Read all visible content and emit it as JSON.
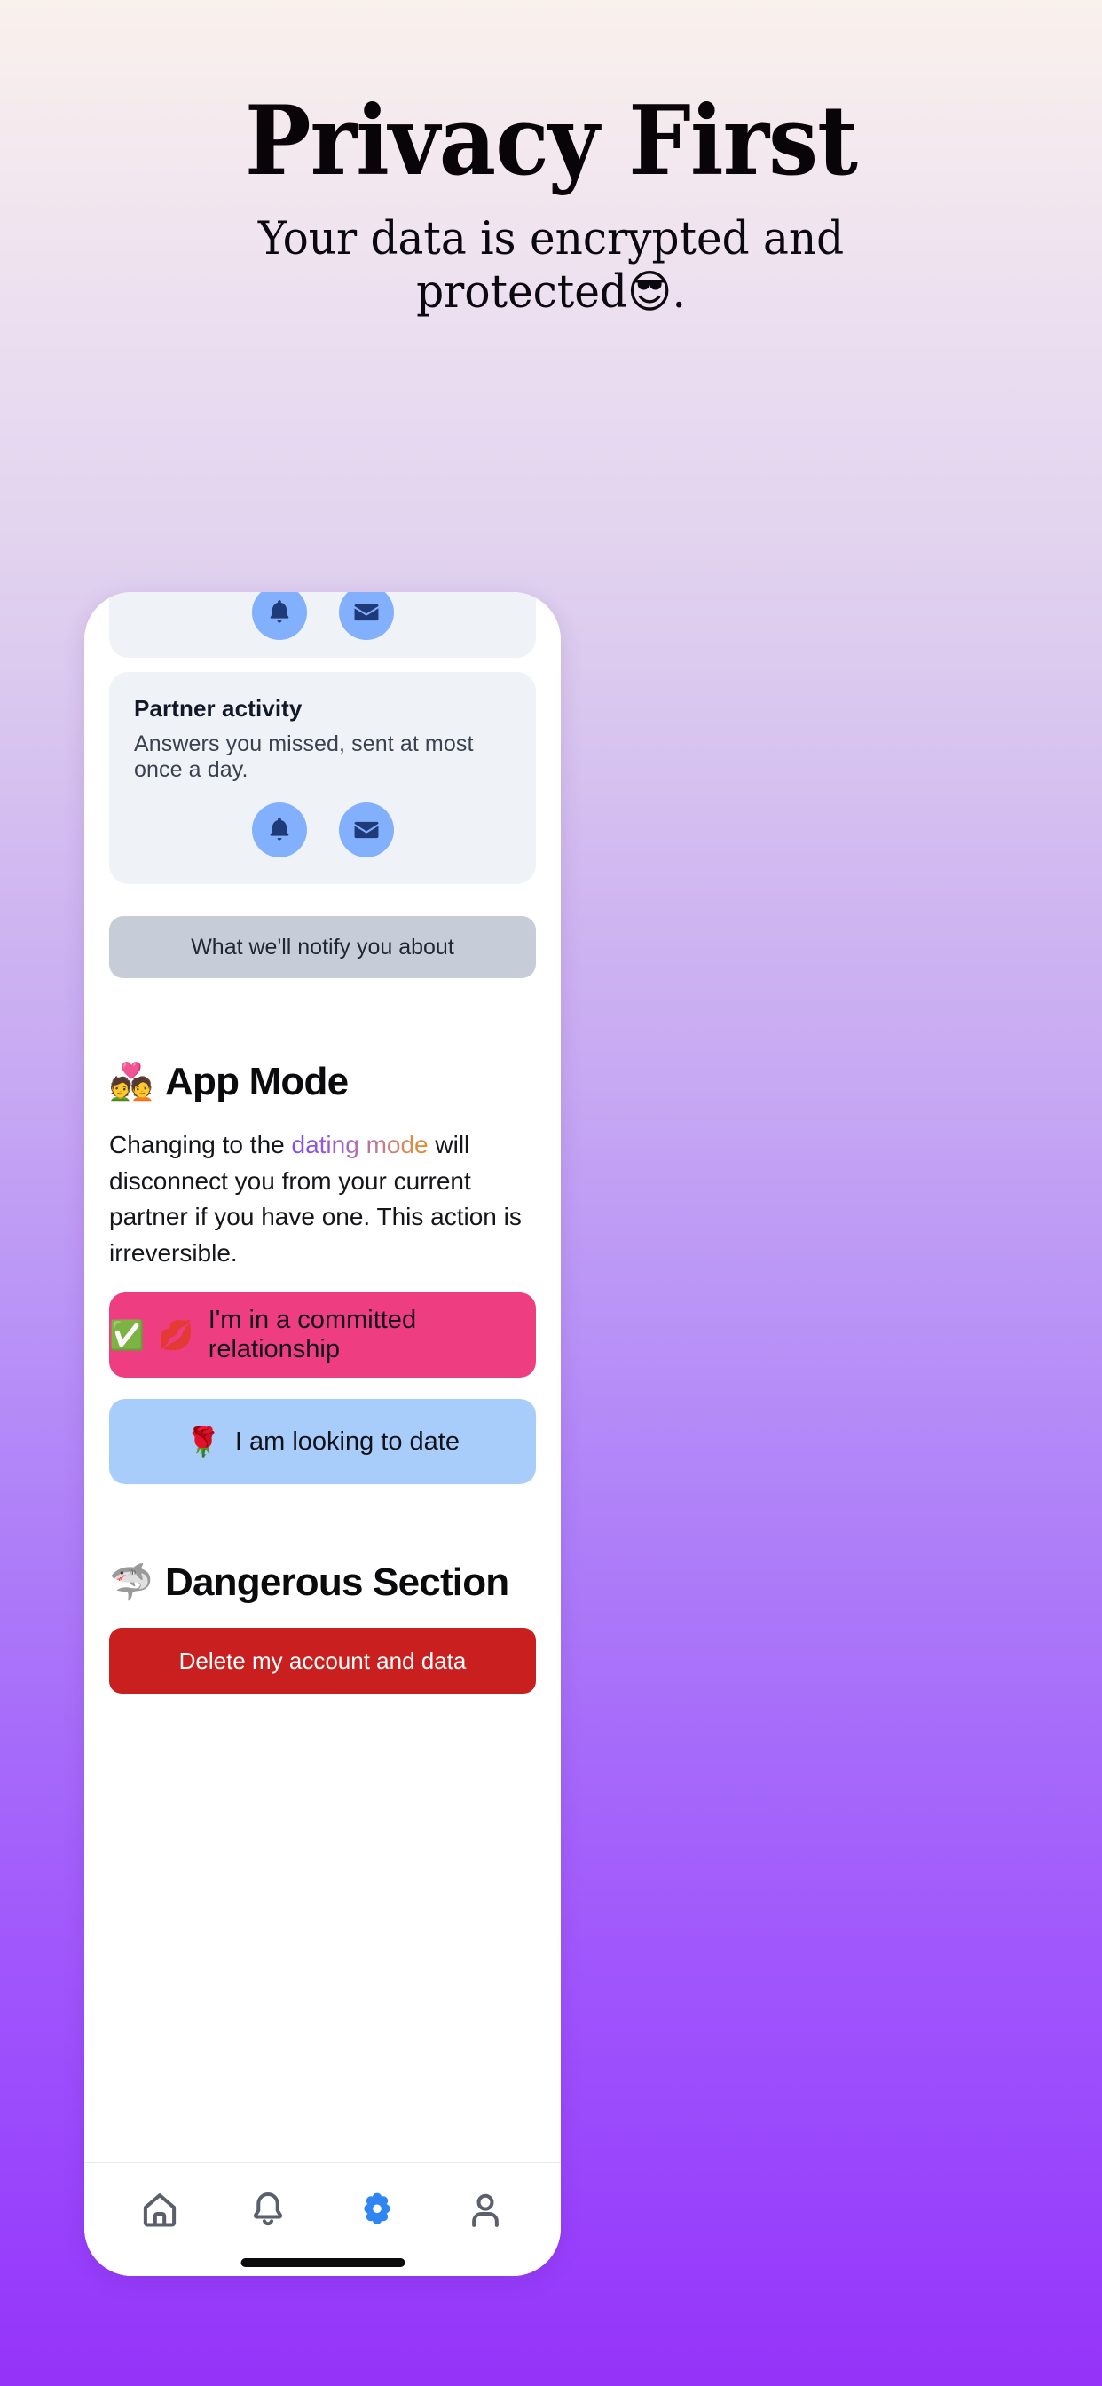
{
  "hero": {
    "title": "Privacy First",
    "subtitle_line1": "Your data is encrypted and",
    "subtitle_line2": "protected",
    "subtitle_emoji": "😎",
    "subtitle_tail": "."
  },
  "phone": {
    "top_card": {
      "icons": [
        {
          "name": "bell-icon",
          "glyph": "bell"
        },
        {
          "name": "envelope-icon",
          "glyph": "envelope"
        }
      ]
    },
    "partner_card": {
      "title": "Partner activity",
      "description": "Answers you missed, sent at most once a day.",
      "icons": [
        {
          "name": "bell-icon",
          "glyph": "bell"
        },
        {
          "name": "envelope-icon",
          "glyph": "envelope"
        }
      ]
    },
    "notify_bar": {
      "label": "What we'll notify you about"
    },
    "app_mode": {
      "emoji": "💑",
      "heading": "App Mode",
      "paragraph_before": "Changing to the ",
      "paragraph_highlight": "dating mode",
      "paragraph_after": " will disconnect you from your current partner if you have one. This action is irreversible.",
      "buttons": [
        {
          "name": "committed-relationship-button",
          "emoji_check": "✅",
          "emoji_kiss": "💋",
          "label": "I'm in a committed relationship",
          "color": "#ef3d82"
        },
        {
          "name": "looking-to-date-button",
          "emoji_rose": "🌹",
          "label": "I am looking to date",
          "color": "#a9cdfb"
        }
      ]
    },
    "dangerous_section": {
      "emoji": "🦈",
      "heading": "Dangerous Section",
      "delete_button_label": "Delete my account and data",
      "delete_button_color": "#ca1f1f"
    },
    "bottom_nav": {
      "items": [
        {
          "name": "nav-home",
          "icon": "home-icon",
          "active": false
        },
        {
          "name": "nav-notifications",
          "icon": "bell-icon",
          "active": false
        },
        {
          "name": "nav-settings",
          "icon": "gear-icon",
          "active": true
        },
        {
          "name": "nav-profile",
          "icon": "person-icon",
          "active": false
        }
      ],
      "active_color": "#2f86f2"
    }
  },
  "colors": {
    "background_top": "#f9f1ec",
    "background_bottom": "#9533f8",
    "card_bg": "#eff2f7",
    "icon_circle": "#83b0fd",
    "icon_glyph": "#1e3a79"
  }
}
